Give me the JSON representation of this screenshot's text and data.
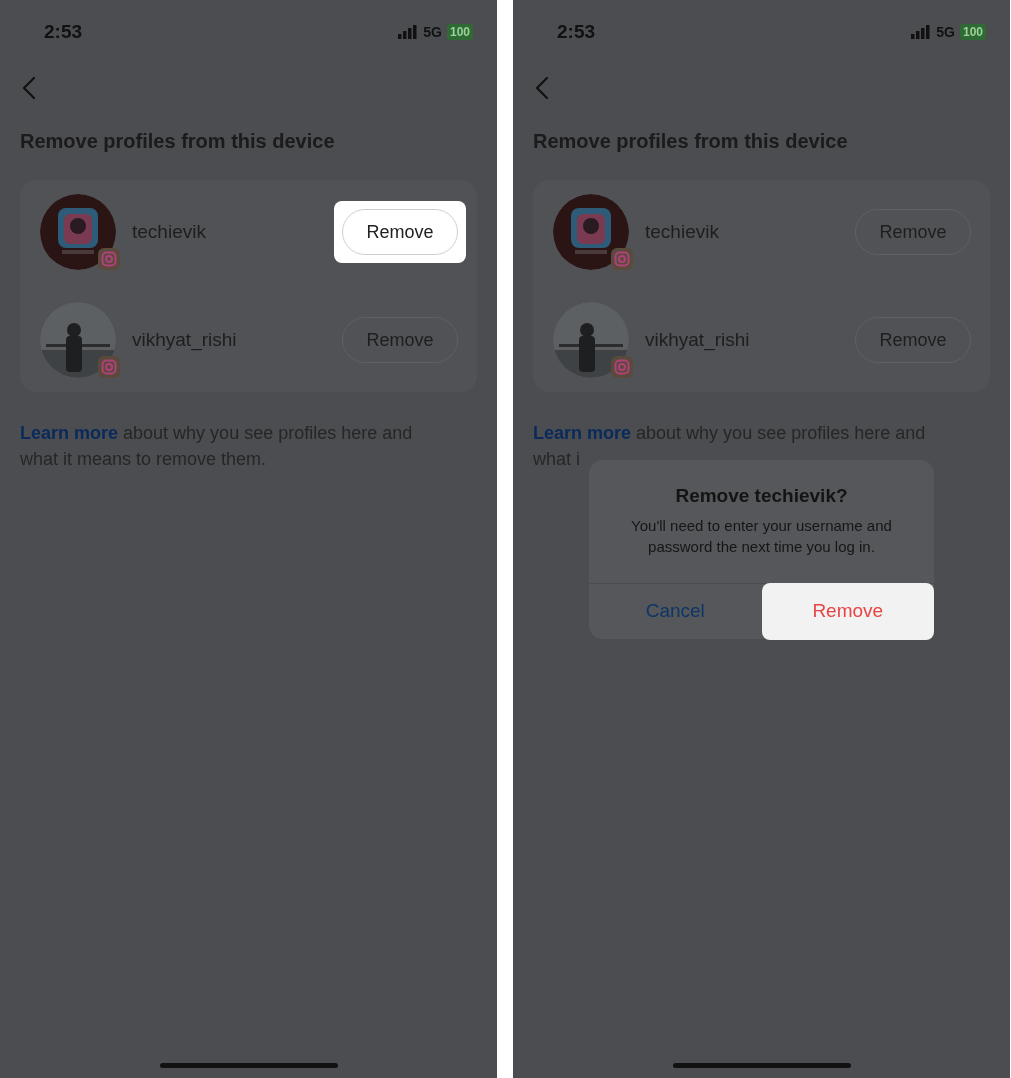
{
  "screens": [
    {
      "status_bar": {
        "time": "2:53",
        "network": "5G",
        "battery": "100"
      },
      "title": "Remove profiles from this device",
      "profiles": [
        {
          "username": "techievik",
          "action": "Remove",
          "highlighted": true
        },
        {
          "username": "vikhyat_rishi",
          "action": "Remove",
          "highlighted": false
        }
      ],
      "learn_more": {
        "link": "Learn more",
        "text": "about why you see profiles here and what it means to remove them."
      }
    },
    {
      "status_bar": {
        "time": "2:53",
        "network": "5G",
        "battery": "100"
      },
      "title": "Remove profiles from this device",
      "profiles": [
        {
          "username": "techievik",
          "action": "Remove",
          "highlighted": false
        },
        {
          "username": "vikhyat_rishi",
          "action": "Remove",
          "highlighted": false
        }
      ],
      "learn_more": {
        "link": "Learn more",
        "text": "about why you see profiles here and what i"
      },
      "dialog": {
        "title": "Remove techievik?",
        "message": "You'll need to enter your username and password the next time you log in.",
        "buttons": [
          {
            "label": "Cancel",
            "kind": "cancel",
            "highlighted": false
          },
          {
            "label": "Remove",
            "kind": "destructive",
            "highlighted": true
          }
        ]
      }
    }
  ]
}
